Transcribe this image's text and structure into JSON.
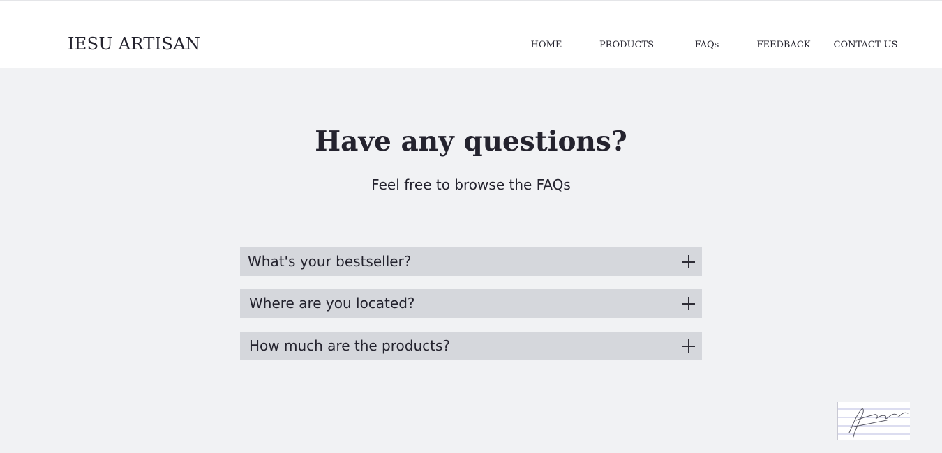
{
  "header": {
    "logo": "IESU ARTISAN",
    "nav": [
      {
        "label": "HOME"
      },
      {
        "label": "PRODUCTS"
      },
      {
        "label": "FAQs"
      },
      {
        "label": "FEEDBACK"
      },
      {
        "label": "CONTACT US"
      }
    ]
  },
  "hero": {
    "title": "Have any questions?",
    "subtitle": "Feel free to browse the FAQs"
  },
  "faqs": [
    {
      "question": "What's your bestseller?",
      "icon": "plus-icon"
    },
    {
      "question": "Where are you located?",
      "icon": "plus-icon"
    },
    {
      "question": "How much are the products?",
      "icon": "plus-icon"
    }
  ],
  "badge": {
    "icon": "signature-icon"
  }
}
